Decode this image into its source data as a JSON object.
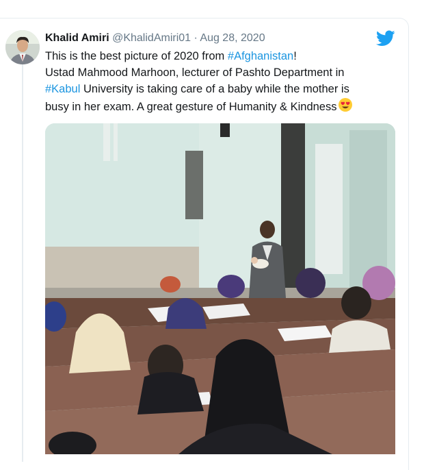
{
  "tweet": {
    "author_name": "Khalid Amiri",
    "handle": "@KhalidAmiri01",
    "separator": "·",
    "date": "Aug 28, 2020",
    "text_line1_prefix": "This is the best picture of 2020 from ",
    "hashtag1": "#Afghanistan",
    "text_line1_suffix": "!",
    "text_line2": "Ustad Mahmood Marhoon, lecturer of Pashto Department in",
    "hashtag2": "#Kabul",
    "text_line3_suffix": " University is taking care of a baby while the mother is",
    "text_line4": "busy in her exam. A great gesture of Humanity & Kindness",
    "emoji": "smiling-face-with-heart-eyes"
  },
  "colors": {
    "twitter_blue": "#1da1f2",
    "hashtag": "#1b95e0",
    "text": "#14171a",
    "muted": "#657786"
  },
  "icons": {
    "brand": "twitter-bird-icon"
  }
}
